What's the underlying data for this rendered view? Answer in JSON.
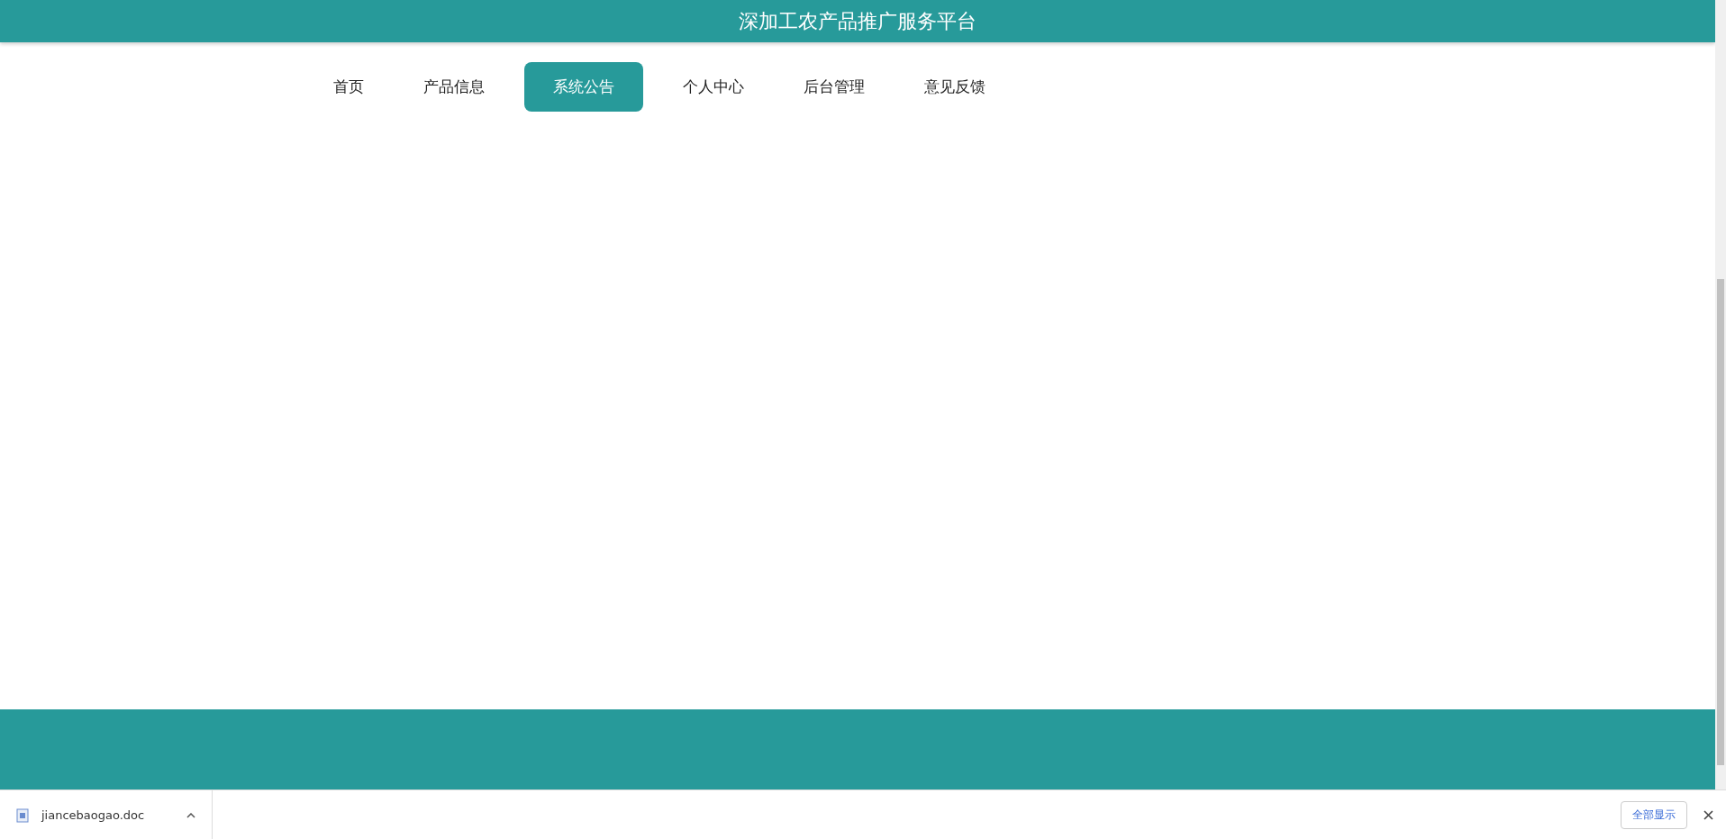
{
  "header": {
    "title": "深加工农产品推广服务平台"
  },
  "nav": [
    {
      "label": "首页",
      "selected": false
    },
    {
      "label": "产品信息",
      "selected": false
    },
    {
      "label": "系统公告",
      "selected": true
    },
    {
      "label": "个人中心",
      "selected": false
    },
    {
      "label": "后台管理",
      "selected": false
    },
    {
      "label": "意见反馈",
      "selected": false
    }
  ],
  "download_bar": {
    "file": "jiancebaogao.doc",
    "show_all": "全部显示"
  }
}
